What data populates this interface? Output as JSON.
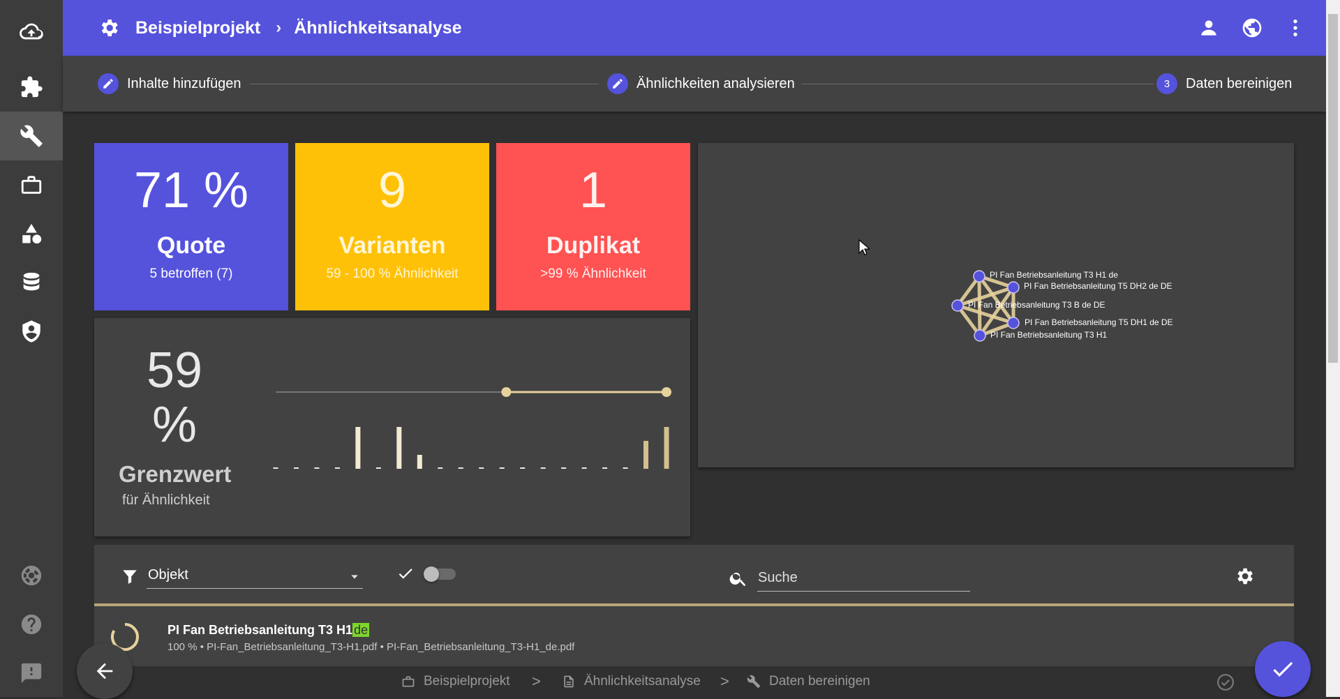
{
  "header": {
    "project": "Beispielprojekt",
    "page": "Ähnlichkeitsanalyse",
    "separator": "›"
  },
  "stepper": {
    "steps": [
      {
        "label": "Inhalte hinzufügen",
        "state": "edit"
      },
      {
        "label": "Ähnlichkeiten analysieren",
        "state": "edit"
      },
      {
        "label": "Daten bereinigen",
        "state": "active",
        "number": "3"
      }
    ]
  },
  "kpis": {
    "quote": {
      "value": "71 %",
      "label": "Quote",
      "sub": "5 betroffen (7)",
      "color": "#5552dc"
    },
    "variants": {
      "value": "9",
      "label": "Varianten",
      "sub": "59 - 100 % Ähnlichkeit",
      "color": "#ffc107"
    },
    "duplicates": {
      "value": "1",
      "label": "Duplikat",
      "sub": ">99 % Ähnlichkeit",
      "color": "#ff5252"
    }
  },
  "threshold": {
    "value": "59 %",
    "label": "Grenzwert",
    "sub": "für Ähnlichkeit",
    "range_min": 59,
    "range_max": 100,
    "histogram": [
      0,
      0,
      0,
      0,
      3,
      0,
      3,
      1,
      0,
      0,
      0,
      0,
      0,
      0,
      0,
      0,
      0,
      0,
      2,
      3
    ],
    "accent": "#e6d29c"
  },
  "graph": {
    "nodes": [
      {
        "label": "PI Fan Betriebsanleitung T3 H1 de"
      },
      {
        "label": "PI Fan Betriebsanleitung T5 DH2 de DE"
      },
      {
        "label": "PI Fan Betriebsanleitung T3 B de DE"
      },
      {
        "label": "PI Fan Betriebsanleitung T5 DH1 de DE"
      },
      {
        "label": "PI Fan Betriebsanleitung T3 H1"
      }
    ],
    "node_color": "#5552dc",
    "edge_color": "#e6d29c"
  },
  "toolbar": {
    "filter_value": "Objekt",
    "search_placeholder": "Suche"
  },
  "list": {
    "items": [
      {
        "title": "PI Fan Betriebsanleitung T3 H1",
        "highlight": "de",
        "meta": "100 % • PI-Fan_Betriebsanleitung_T3-H1.pdf • PI-Fan_Betriebsanleitung_T3-H1_de.pdf"
      }
    ]
  },
  "footer": {
    "crumbs": [
      "Beispielprojekt",
      "Ähnlichkeitsanalyse",
      "Daten bereinigen"
    ],
    "separator": ">"
  }
}
